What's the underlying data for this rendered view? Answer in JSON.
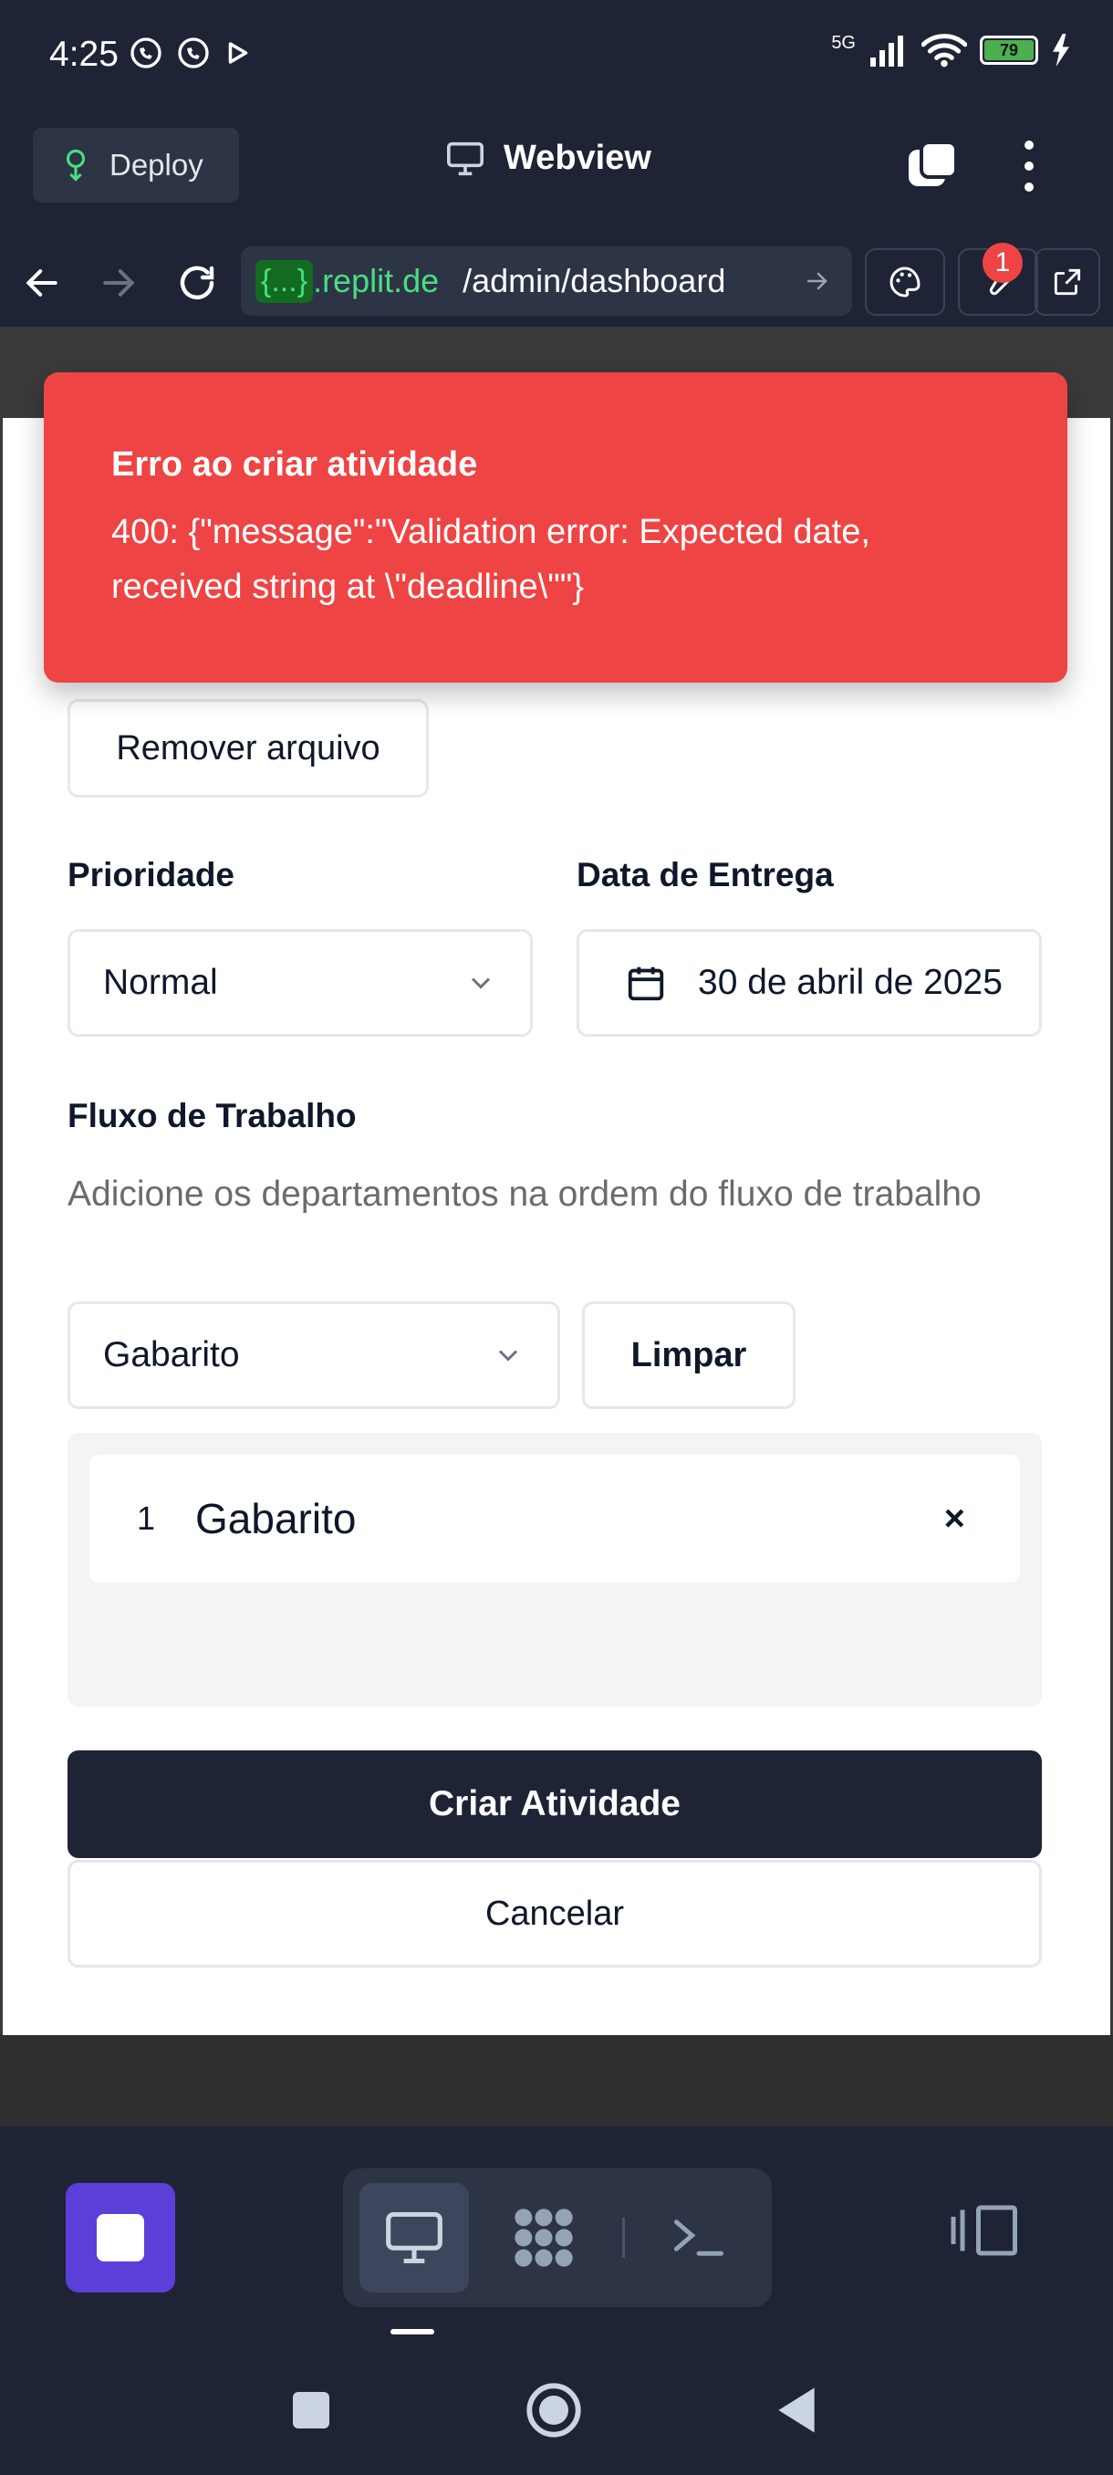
{
  "status_bar": {
    "time": "4:25",
    "network": "5G",
    "battery": "79"
  },
  "topbar": {
    "deploy_label": "Deploy",
    "title": "Webview"
  },
  "url_bar": {
    "badge": "{...}",
    "domain": ".replit.de",
    "path": "/admin/dashboard",
    "notification_count": "1"
  },
  "toast": {
    "title": "Erro ao criar atividade",
    "message": "400: {\"message\":\"Validation error: Expected date, received string at \\\"deadline\\\"\"}"
  },
  "form": {
    "remove_file_label": "Remover arquivo",
    "priority_label": "Prioridade",
    "priority_value": "Normal",
    "deadline_label": "Data de Entrega",
    "deadline_value": "30 de abril de 2025",
    "workflow_label": "Fluxo de Trabalho",
    "workflow_hint": "Adicione os departamentos na ordem do fluxo de trabalho",
    "department_select_value": "Gabarito",
    "clear_label": "Limpar",
    "workflow_items": [
      {
        "order": "1",
        "name": "Gabarito",
        "remove": "×"
      }
    ],
    "submit_label": "Criar Atividade",
    "cancel_label": "Cancelar"
  },
  "colors": {
    "app_background": "#1e2435",
    "toast_background": "#ef4444",
    "primary_button": "#1e2435",
    "stop_button": "#5b3fd8",
    "url_domain": "#4ade80"
  },
  "icons": {
    "deploy": "deploy-icon",
    "webview": "monitor-icon",
    "calendar": "calendar-icon",
    "chevron": "chevron-down-icon"
  }
}
